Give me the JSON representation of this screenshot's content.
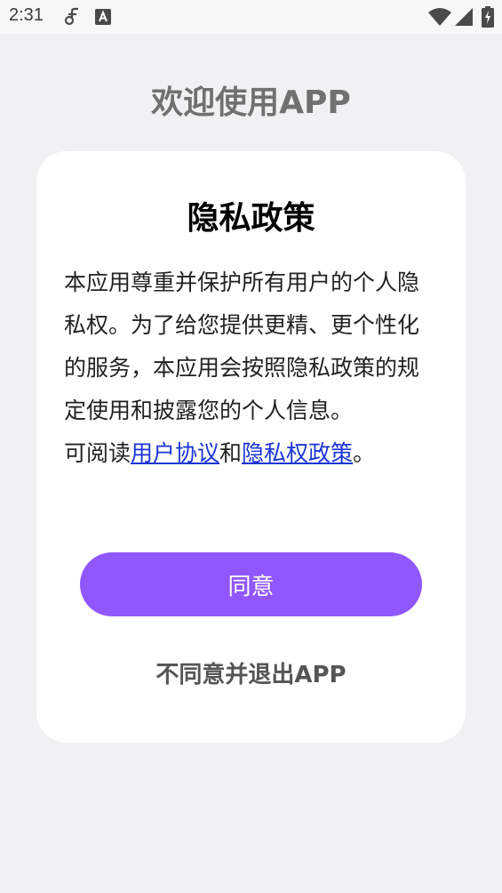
{
  "status_bar": {
    "time": "2:31",
    "icons": [
      "link-notification-icon",
      "text-notification-icon",
      "wifi-icon",
      "signal-icon",
      "battery-charging-icon"
    ]
  },
  "screen": {
    "welcome_title": "欢迎使用APP"
  },
  "dialog": {
    "title": "隐私政策",
    "body_text": "本应用尊重并保护所有用户的个人隐私权。为了给您提供更精、更个性化的服务，本应用会按照隐私政策的规定使用和披露您的个人信息。",
    "read_prefix": "可阅读",
    "user_agreement_link": "用户协议",
    "conjunction": "和",
    "privacy_policy_link": "隐私权政策",
    "period": "。",
    "agree_label": "同意",
    "disagree_label": "不同意并退出APP"
  },
  "colors": {
    "background": "#f1f1f3",
    "card": "#ffffff",
    "accent": "#9157ff",
    "link": "#1a35d6"
  }
}
